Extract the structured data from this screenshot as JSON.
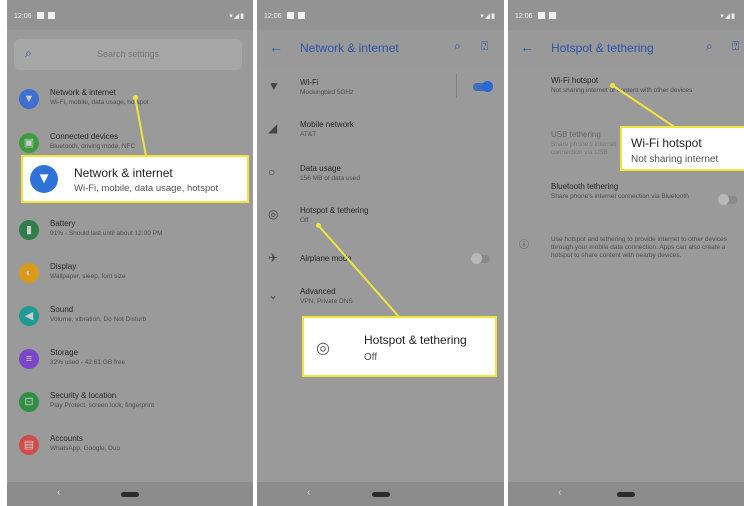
{
  "colors": {
    "accent": "#2a56a8",
    "highlight": "#f1e53c",
    "toggle_on": "#2b68d4"
  },
  "panels": [
    {
      "status": {
        "time": "12:06"
      }
    },
    {
      "status": {
        "time": "12:06"
      }
    },
    {
      "status": {
        "time": "12:06"
      }
    }
  ],
  "settings": {
    "search_placeholder": "Search settings",
    "items": [
      {
        "title": "Network & internet",
        "subtitle": "Wi-Fi, mobile, data usage, hotspot",
        "icon": "wifi-icon",
        "color": "#3f6fd0"
      },
      {
        "title": "Connected devices",
        "subtitle": "Bluetooth, driving mode, NFC",
        "icon": "devices-icon",
        "color": "#3d9a3d"
      },
      {
        "title": "Battery",
        "subtitle": "91% - Should last until about 12:00 PM",
        "icon": "battery-icon",
        "color": "#2f7d4a"
      },
      {
        "title": "Display",
        "subtitle": "Wallpaper, sleep, font size",
        "icon": "display-icon",
        "color": "#d99a1a"
      },
      {
        "title": "Sound",
        "subtitle": "Volume, vibration, Do Not Disturb",
        "icon": "sound-icon",
        "color": "#1e9b94"
      },
      {
        "title": "Storage",
        "subtitle": "32% used - 42.61 GB free",
        "icon": "storage-icon",
        "color": "#7b45c8"
      },
      {
        "title": "Security & location",
        "subtitle": "Play Protect, screen lock, fingerprint",
        "icon": "lock-icon",
        "color": "#2f8f45"
      },
      {
        "title": "Accounts",
        "subtitle": "WhatsApp, Google, Duo",
        "icon": "accounts-icon",
        "color": "#d34a4a"
      }
    ]
  },
  "network": {
    "title": "Network & internet",
    "items": [
      {
        "title": "Wi-Fi",
        "subtitle": "Mockingbird 5GHz",
        "icon": "wifi-icon",
        "toggle": "on"
      },
      {
        "title": "Mobile network",
        "subtitle": "AT&T",
        "icon": "signal-icon"
      },
      {
        "title": "Data usage",
        "subtitle": "156 MB of data used",
        "icon": "data-usage-icon"
      },
      {
        "title": "Hotspot & tethering",
        "subtitle": "Off",
        "icon": "hotspot-icon"
      },
      {
        "title": "Airplane mode",
        "subtitle": "",
        "icon": "airplane-icon",
        "toggle": "off"
      },
      {
        "title": "Advanced",
        "subtitle": "VPN, Private DNS",
        "icon": "chevron-down-icon"
      }
    ]
  },
  "hotspot": {
    "title": "Hotspot & tethering",
    "items": [
      {
        "title": "Wi-Fi hotspot",
        "subtitle": "Not sharing internet or content with other devices"
      },
      {
        "title": "USB tethering",
        "subtitle": "Share phone's internet connection via USB"
      },
      {
        "title": "Bluetooth tethering",
        "subtitle": "Share phone's internet connection via Bluetooth",
        "toggle": "off"
      }
    ],
    "info": "Use hotspot and tethering to provide internet to other devices through your mobile data connection. Apps can also create a hotspot to share content with nearby devices."
  },
  "callouts": {
    "network": {
      "title": "Network & internet",
      "subtitle": "Wi-Fi, mobile, data usage, hotspot"
    },
    "hotspot": {
      "title": "Hotspot & tethering",
      "subtitle": "Off"
    },
    "wifi_hotspot": {
      "title": "Wi-Fi hotspot",
      "subtitle": "Not sharing internet"
    }
  }
}
